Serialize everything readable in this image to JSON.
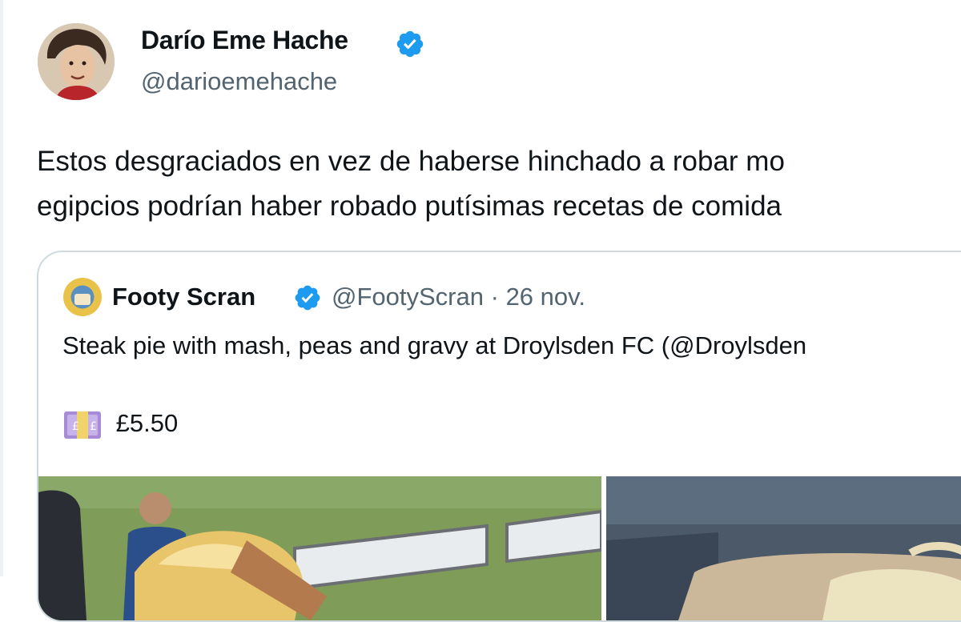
{
  "tweet": {
    "author": {
      "display_name": "Darío Eme Hache",
      "handle": "@darioemehache",
      "verified": true
    },
    "text_lines": [
      "Estos desgraciados en vez de haberse hinchado a robar mo",
      "egipcios podrían haber robado putísimas recetas de comida"
    ]
  },
  "quote": {
    "author": {
      "display_name": "Footy Scran",
      "handle": "@FootyScran",
      "separator": "·",
      "date": "26 nov.",
      "verified": true
    },
    "text": "Steak pie with mash, peas and gravy at Droylsden FC (@Droylsden",
    "price": "£5.50",
    "price_icon": "money-with-pound-icon",
    "media": [
      "food-photo-steak-pie-pitchside",
      "food-photo-mash-in-tray"
    ]
  },
  "colors": {
    "text": "#0f1419",
    "secondary_text": "#536471",
    "verified": "#1d9bf0",
    "border": "#cfd9de"
  }
}
